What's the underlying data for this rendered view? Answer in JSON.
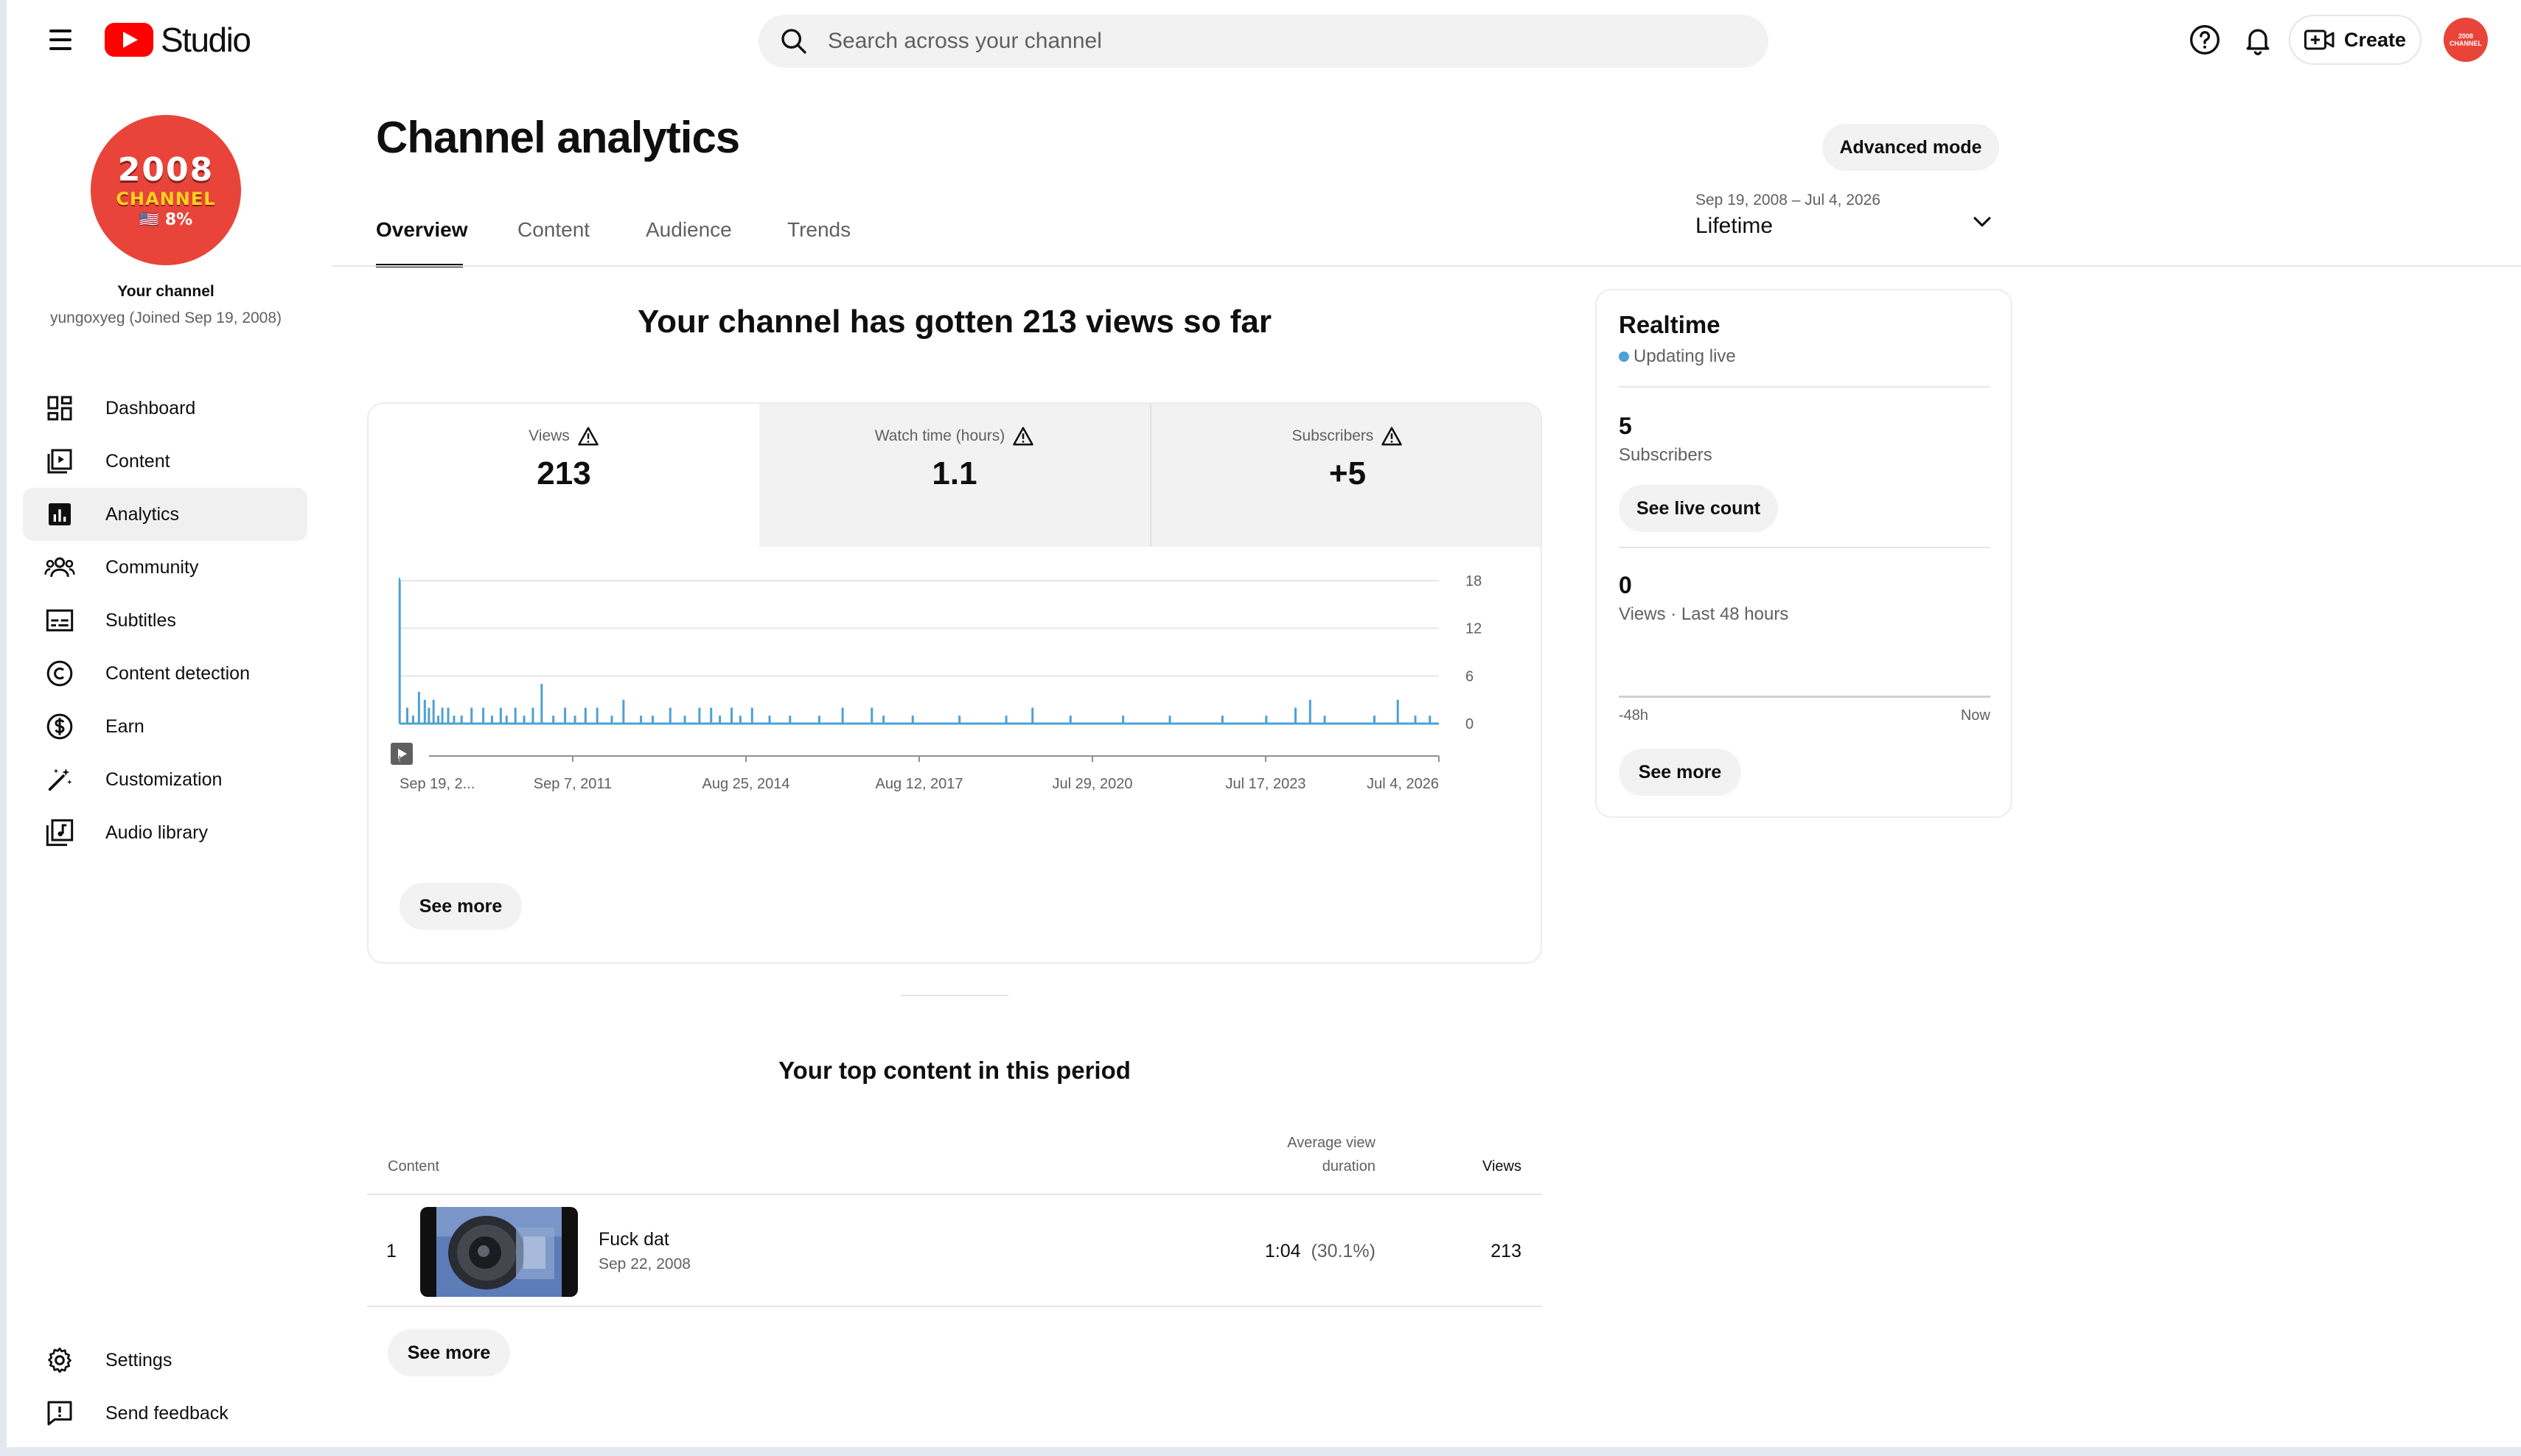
{
  "app": {
    "logo_text": "Studio",
    "search_placeholder": "Search across your channel",
    "create_label": "Create",
    "avatar_text": "2008 CHANNEL"
  },
  "channel": {
    "avatar_year": "2008",
    "avatar_channel": "CHANNEL",
    "avatar_pct": "🇺🇸 8%",
    "title": "Your channel",
    "subtitle": "yungoxyeg (Joined Sep 19, 2008)"
  },
  "sidebar": {
    "items": [
      {
        "label": "Dashboard",
        "icon": "dashboard-icon"
      },
      {
        "label": "Content",
        "icon": "content-icon"
      },
      {
        "label": "Analytics",
        "icon": "analytics-icon",
        "active": true
      },
      {
        "label": "Community",
        "icon": "community-icon"
      },
      {
        "label": "Subtitles",
        "icon": "subtitles-icon"
      },
      {
        "label": "Content detection",
        "icon": "copyright-icon"
      },
      {
        "label": "Earn",
        "icon": "dollar-icon"
      },
      {
        "label": "Customization",
        "icon": "magic-wand-icon"
      },
      {
        "label": "Audio library",
        "icon": "audio-library-icon"
      }
    ],
    "bottom": [
      {
        "label": "Settings",
        "icon": "gear-icon"
      },
      {
        "label": "Send feedback",
        "icon": "feedback-icon"
      }
    ]
  },
  "page": {
    "title": "Channel analytics",
    "advanced_mode": "Advanced mode",
    "tabs": [
      "Overview",
      "Content",
      "Audience",
      "Trends"
    ],
    "active_tab": "Overview",
    "range_dates": "Sep 19, 2008 – Jul 4, 2026",
    "range_label": "Lifetime"
  },
  "overview": {
    "headline": "Your channel has gotten 213 views so far",
    "metrics": [
      {
        "label": "Views",
        "value": "213",
        "active": true
      },
      {
        "label": "Watch time (hours)",
        "value": "1.1",
        "active": false
      },
      {
        "label": "Subscribers",
        "value": "+5",
        "active": false
      }
    ],
    "see_more": "See more"
  },
  "chart_data": {
    "type": "bar",
    "title": "",
    "xlabel": "",
    "ylabel": "",
    "x_tick_labels": [
      "Sep 19, 2...",
      "Sep 7, 2011",
      "Aug 25, 2014",
      "Aug 12, 2017",
      "Jul 29, 2020",
      "Jul 17, 2023",
      "Jul 4, 2026"
    ],
    "y_ticks": [
      0,
      6,
      12,
      18
    ],
    "ylim": [
      0,
      18
    ],
    "xlim": [
      "2008-09-19",
      "2026-07-04"
    ],
    "grid": true,
    "y_axis_side": "right",
    "color": "#4ea1d3",
    "series": [
      {
        "values": [
          [
            2008.72,
            18
          ],
          [
            2008.85,
            2
          ],
          [
            2008.95,
            1
          ],
          [
            2009.05,
            4
          ],
          [
            2009.15,
            3
          ],
          [
            2009.22,
            2
          ],
          [
            2009.3,
            3
          ],
          [
            2009.38,
            1
          ],
          [
            2009.45,
            2
          ],
          [
            2009.55,
            2
          ],
          [
            2009.65,
            1
          ],
          [
            2009.78,
            1
          ],
          [
            2009.95,
            2
          ],
          [
            2010.15,
            2
          ],
          [
            2010.3,
            1
          ],
          [
            2010.45,
            2
          ],
          [
            2010.55,
            1
          ],
          [
            2010.7,
            2
          ],
          [
            2010.85,
            1
          ],
          [
            2011.0,
            2
          ],
          [
            2011.15,
            5
          ],
          [
            2011.35,
            1
          ],
          [
            2011.55,
            2
          ],
          [
            2011.72,
            1
          ],
          [
            2011.9,
            2
          ],
          [
            2012.1,
            2
          ],
          [
            2012.35,
            1
          ],
          [
            2012.55,
            3
          ],
          [
            2012.85,
            1
          ],
          [
            2013.05,
            1
          ],
          [
            2013.35,
            2
          ],
          [
            2013.6,
            1
          ],
          [
            2013.85,
            2
          ],
          [
            2014.05,
            2
          ],
          [
            2014.2,
            1
          ],
          [
            2014.4,
            2
          ],
          [
            2014.55,
            1
          ],
          [
            2014.75,
            2
          ],
          [
            2015.05,
            1
          ],
          [
            2015.4,
            1
          ],
          [
            2015.9,
            1
          ],
          [
            2016.3,
            2
          ],
          [
            2016.8,
            2
          ],
          [
            2017.0,
            1
          ],
          [
            2017.5,
            1
          ],
          [
            2018.3,
            1
          ],
          [
            2019.1,
            1
          ],
          [
            2019.55,
            2
          ],
          [
            2020.2,
            1
          ],
          [
            2021.1,
            1
          ],
          [
            2021.9,
            1
          ],
          [
            2022.8,
            1
          ],
          [
            2023.55,
            1
          ],
          [
            2024.05,
            2
          ],
          [
            2024.3,
            3
          ],
          [
            2024.55,
            1
          ],
          [
            2025.4,
            1
          ],
          [
            2025.8,
            3
          ],
          [
            2026.1,
            1
          ],
          [
            2026.35,
            1
          ]
        ]
      }
    ]
  },
  "top_content": {
    "title": "Your top content in this period",
    "headers": {
      "content": "Content",
      "avg1": "Average view",
      "avg2": "duration",
      "views": "Views"
    },
    "rows": [
      {
        "rank": "1",
        "title": "Fuck dat",
        "date": "Sep 22, 2008",
        "avg": "1:04",
        "avg_pct": "(30.1%)",
        "views": "213"
      }
    ],
    "see_more": "See more"
  },
  "realtime": {
    "title": "Realtime",
    "status": "Updating live",
    "subs_value": "5",
    "subs_label": "Subscribers",
    "live_count_btn": "See live count",
    "views_value": "0",
    "views_label": "Views · Last 48 hours",
    "axis_start": "-48h",
    "axis_end": "Now",
    "see_more": "See more"
  }
}
